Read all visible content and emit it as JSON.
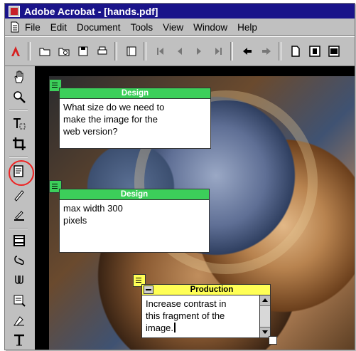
{
  "window": {
    "title": "Adobe Acrobat - [hands.pdf]"
  },
  "menu": [
    "File",
    "Edit",
    "Document",
    "Tools",
    "View",
    "Window",
    "Help"
  ],
  "toolbar": {
    "icons": [
      "acrobat-logo-icon",
      "open-folder-icon",
      "search-folder-icon",
      "save-icon",
      "print-icon",
      "thumbnails-icon",
      "first-page-icon",
      "prev-page-icon",
      "next-page-icon",
      "last-page-icon",
      "go-back-icon",
      "go-forward-icon",
      "actual-size-icon",
      "fit-page-icon",
      "fit-width-icon"
    ]
  },
  "tools": [
    "hand-icon",
    "zoom-icon",
    "text-select-icon",
    "crop-icon",
    "note-tool-icon",
    "pencil-icon",
    "highlight-icon",
    "movie-icon",
    "attach-icon",
    "link-icon",
    "form-icon",
    "signature-icon",
    "touchup-text-icon"
  ],
  "notes": [
    {
      "author": "Design",
      "text": "What size do we need to\nmake the image for the\nweb version?"
    },
    {
      "author": "Design",
      "text": "max width 300\npixels"
    },
    {
      "author": "Production",
      "text": "Increase contrast in\nthis fragment of the\nimage."
    }
  ]
}
